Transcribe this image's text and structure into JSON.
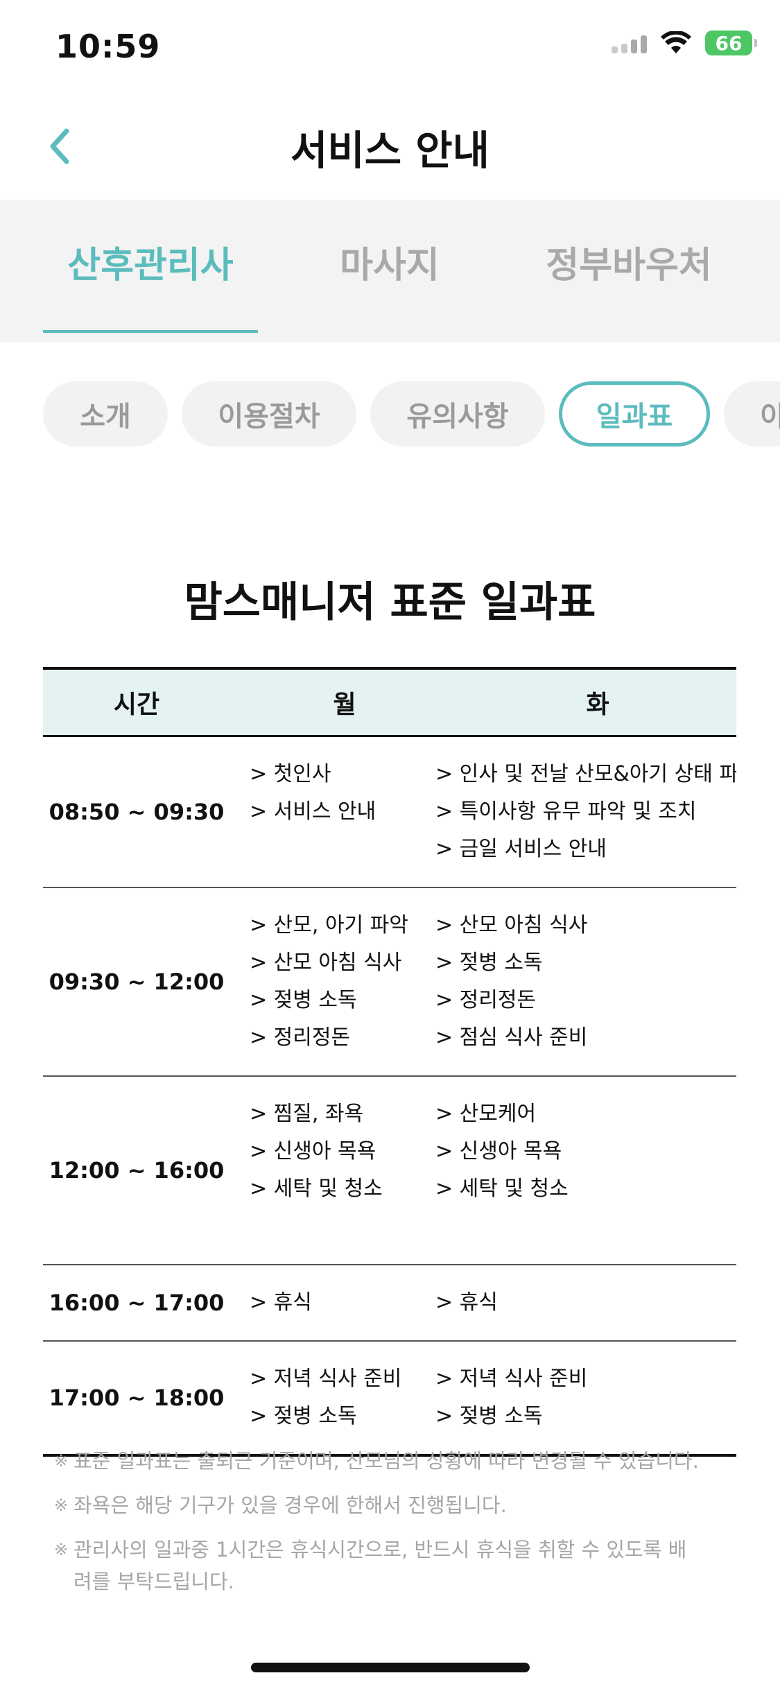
{
  "status_bar": {
    "time": "10:59",
    "battery": "66"
  },
  "header": {
    "title": "서비스 안내"
  },
  "main_tabs": [
    {
      "label": "산후관리사",
      "active": true
    },
    {
      "label": "마사지",
      "active": false
    },
    {
      "label": "정부바우처",
      "active": false
    }
  ],
  "sub_tabs": [
    {
      "label": "소개",
      "active": false
    },
    {
      "label": "이용절차",
      "active": false
    },
    {
      "label": "유의사항",
      "active": false
    },
    {
      "label": "일과표",
      "active": true
    },
    {
      "label": "이",
      "active": false
    }
  ],
  "schedule": {
    "title": "맘스매니저 표준 일과표",
    "headers": {
      "time": "시간",
      "mon": "월",
      "tue": "화"
    },
    "rows": [
      {
        "time": "08:50 ~ 09:30",
        "mon": [
          "> 첫인사",
          "> 서비스 안내"
        ],
        "tue": [
          "> 인사 및 전날 산모&아기 상태 파악",
          "> 특이사항 유무 파악 및 조치",
          "> 금일 서비스 안내"
        ]
      },
      {
        "time": "09:30 ~ 12:00",
        "mon": [
          "> 산모, 아기 파악",
          "> 산모 아침 식사",
          "> 젖병 소독",
          "> 정리정돈"
        ],
        "tue": [
          "> 산모 아침 식사",
          "> 젖병 소독",
          "> 정리정돈",
          "> 점심 식사 준비"
        ]
      },
      {
        "time": "12:00 ~ 16:00",
        "mon": [
          "> 찜질, 좌욕",
          "> 신생아 목욕",
          "> 세탁 및 청소"
        ],
        "tue": [
          "> 산모케어",
          "> 신생아 목욕",
          "> 세탁 및 청소"
        ]
      },
      {
        "time": "16:00 ~ 17:00",
        "mon": [
          "> 휴식"
        ],
        "tue": [
          "> 휴식"
        ]
      },
      {
        "time": "17:00 ~ 18:00",
        "mon": [
          "> 저녁 식사 준비",
          "> 젖병 소독"
        ],
        "tue": [
          "> 저녁 식사 준비",
          "> 젖병 소독"
        ]
      }
    ]
  },
  "notes": [
    "표준 일과표는 출퇴근 기준이며, 산모님의 상황에 따라 변경될 수 있습니다.",
    "좌욕은 해당 기구가 있을 경우에 한해서 진행됩니다.",
    "관리사의 일과중 1시간은 휴식시간으로, 반드시 휴식을 취할 수 있도록 배려를 부탁드립니다."
  ]
}
